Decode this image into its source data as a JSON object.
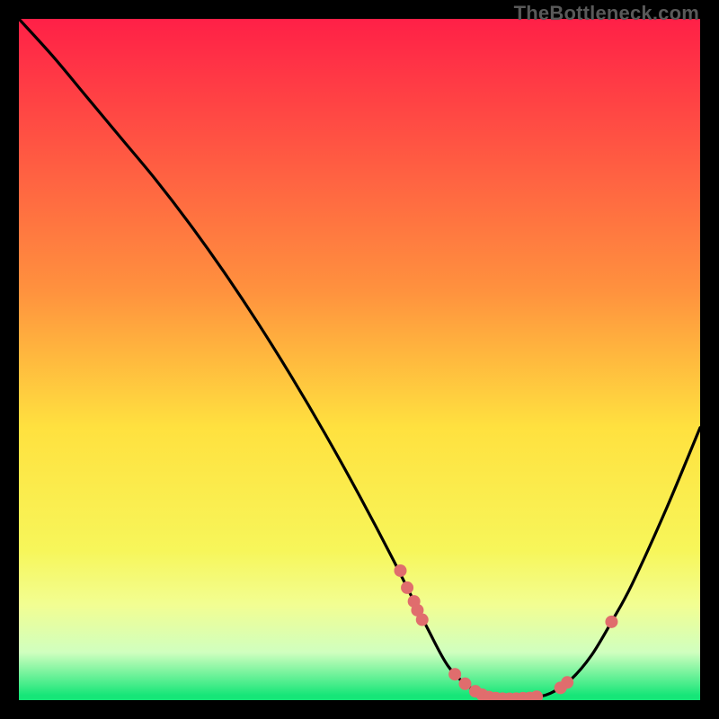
{
  "watermark": {
    "text": "TheBottleneck.com"
  },
  "chart_data": {
    "type": "line",
    "title": "",
    "xlabel": "",
    "ylabel": "",
    "xlim": [
      0,
      100
    ],
    "ylim": [
      0,
      100
    ],
    "background_gradient": {
      "stops": [
        {
          "offset": 0,
          "color": "#ff2047"
        },
        {
          "offset": 40,
          "color": "#ff923e"
        },
        {
          "offset": 60,
          "color": "#ffe13f"
        },
        {
          "offset": 78,
          "color": "#f7f65a"
        },
        {
          "offset": 86,
          "color": "#f2fe92"
        },
        {
          "offset": 93,
          "color": "#d0ffbf"
        },
        {
          "offset": 99.3,
          "color": "#16e678"
        },
        {
          "offset": 100,
          "color": "#16e678"
        }
      ]
    },
    "series": [
      {
        "name": "curve",
        "x": [
          0,
          5,
          10,
          15,
          20,
          25,
          30,
          35,
          40,
          45,
          50,
          55,
          60,
          63,
          66,
          69,
          72,
          75,
          78,
          81,
          84,
          87,
          90,
          95,
          100
        ],
        "y": [
          100,
          94.5,
          88.5,
          82.5,
          76.5,
          70,
          63,
          55.5,
          47.5,
          39,
          30,
          20.5,
          10.5,
          5,
          2,
          0.5,
          0.2,
          0.3,
          1,
          3,
          6.5,
          11.5,
          17,
          28,
          40
        ]
      }
    ],
    "markers": [
      {
        "x": 56.0,
        "y": 19.0
      },
      {
        "x": 57.0,
        "y": 16.5
      },
      {
        "x": 58.0,
        "y": 14.5
      },
      {
        "x": 58.5,
        "y": 13.2
      },
      {
        "x": 59.2,
        "y": 11.8
      },
      {
        "x": 64.0,
        "y": 3.8
      },
      {
        "x": 65.5,
        "y": 2.4
      },
      {
        "x": 67.0,
        "y": 1.3
      },
      {
        "x": 68.0,
        "y": 0.8
      },
      {
        "x": 69.0,
        "y": 0.45
      },
      {
        "x": 70.0,
        "y": 0.3
      },
      {
        "x": 71.0,
        "y": 0.22
      },
      {
        "x": 72.0,
        "y": 0.2
      },
      {
        "x": 73.0,
        "y": 0.22
      },
      {
        "x": 74.0,
        "y": 0.28
      },
      {
        "x": 75.0,
        "y": 0.32
      },
      {
        "x": 76.0,
        "y": 0.5
      },
      {
        "x": 79.5,
        "y": 1.8
      },
      {
        "x": 80.5,
        "y": 2.6
      },
      {
        "x": 87.0,
        "y": 11.5
      }
    ],
    "marker_style": {
      "r": 7,
      "fill": "#e06d6d"
    },
    "curve_style": {
      "stroke": "#000000",
      "stroke_width": 3.2
    }
  }
}
